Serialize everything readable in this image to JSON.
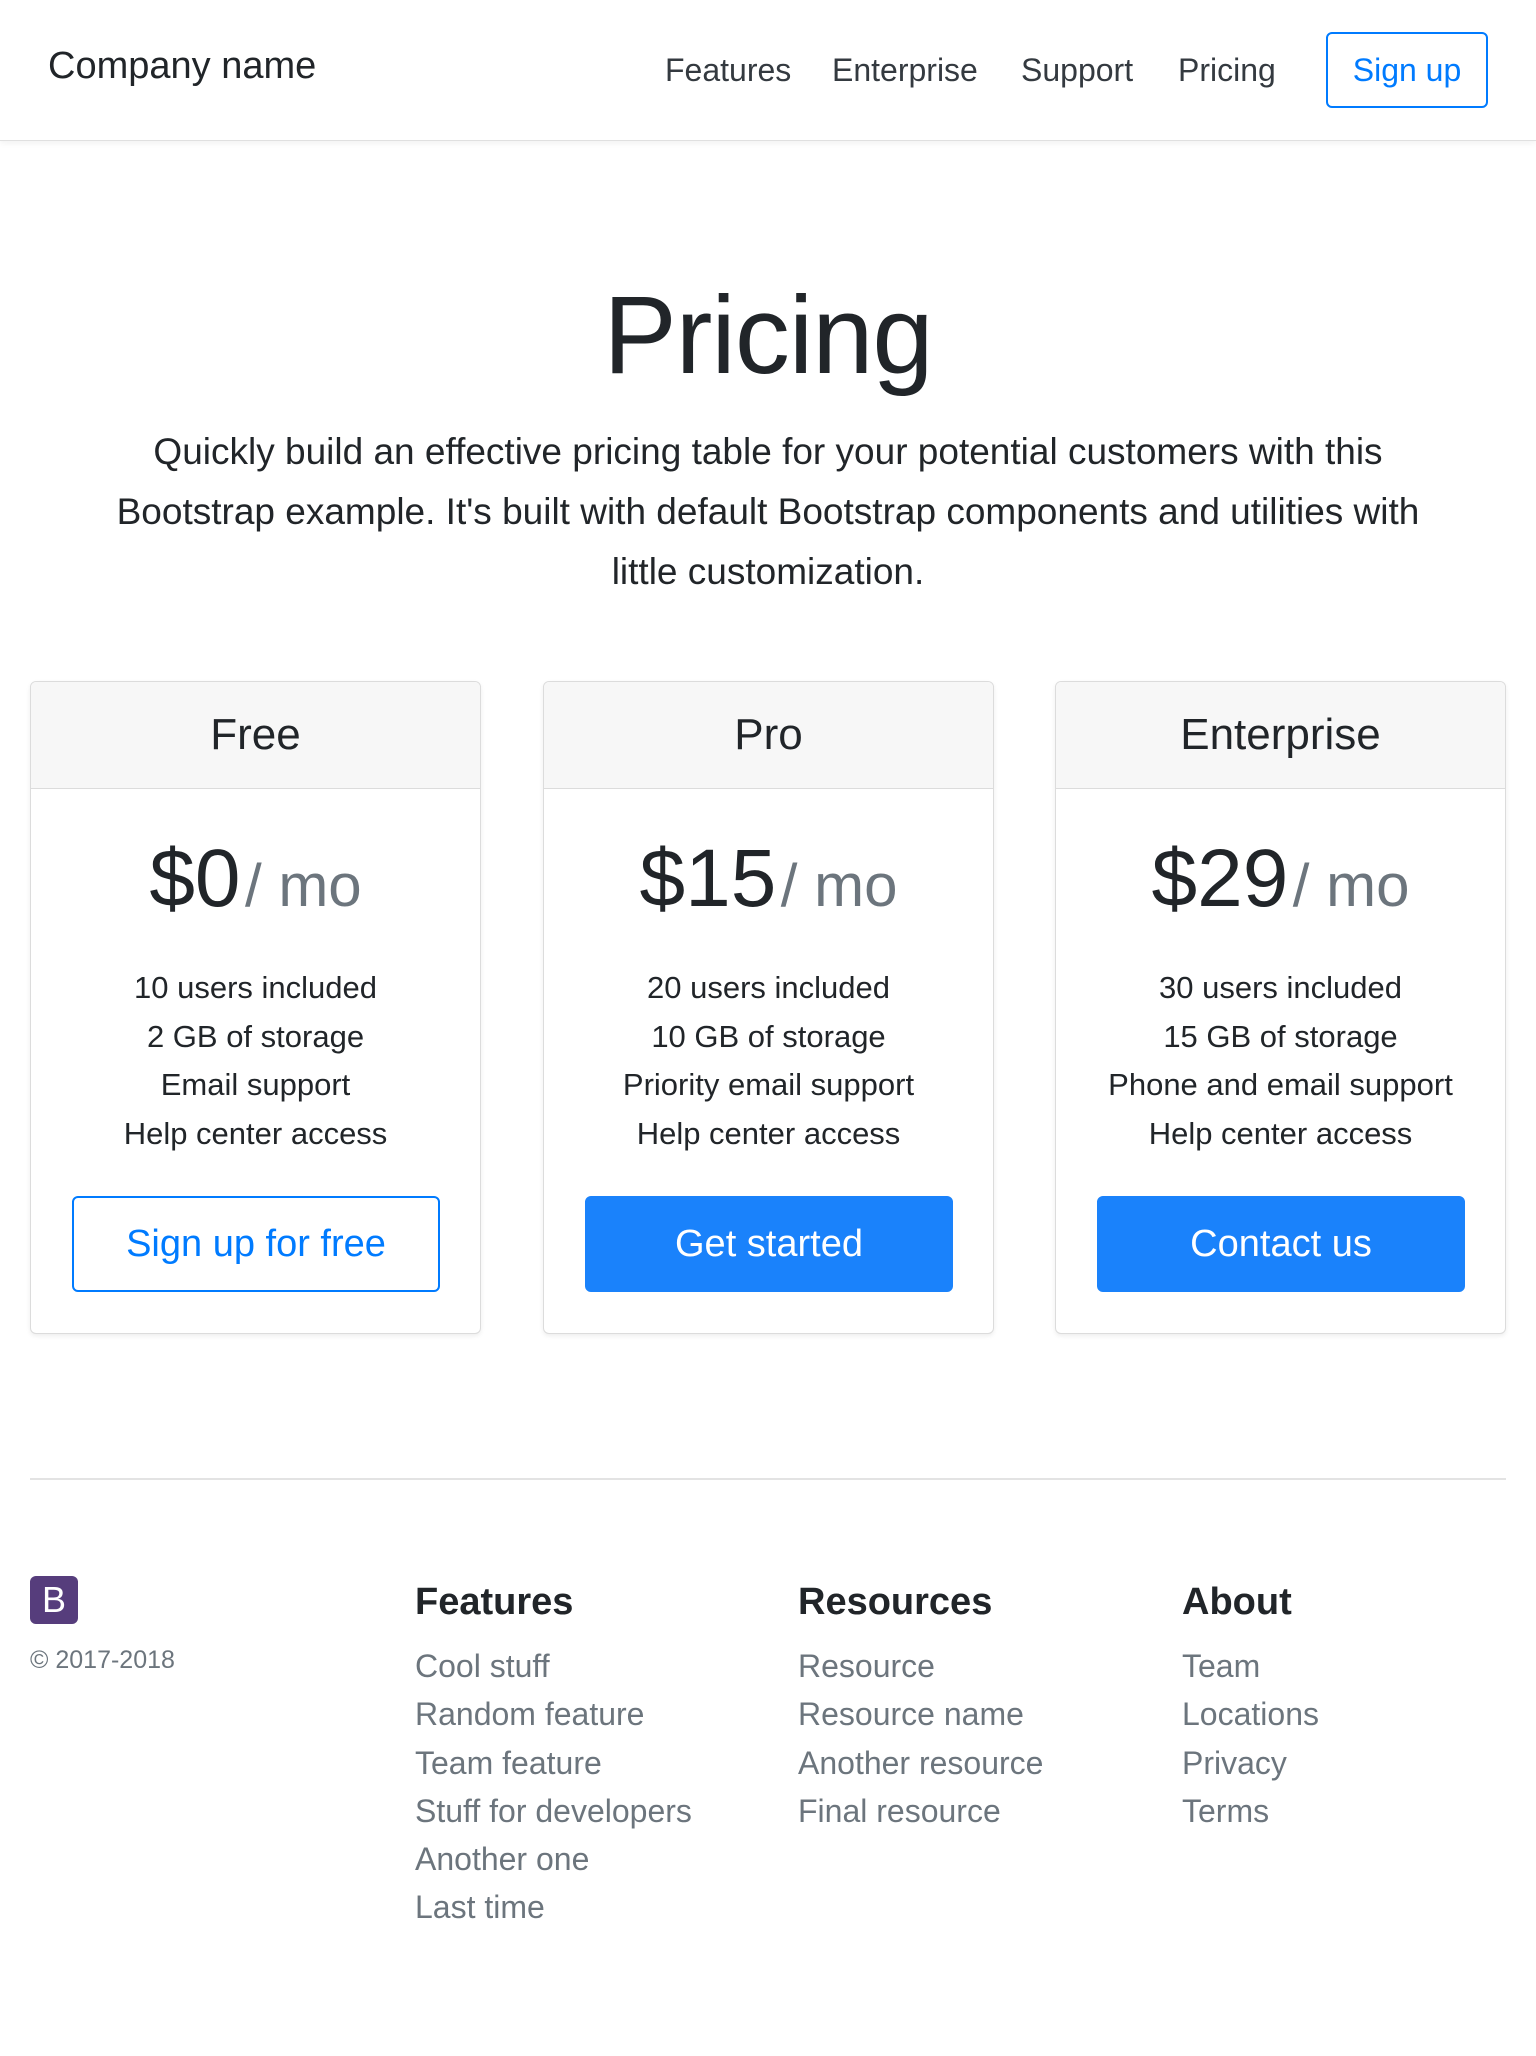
{
  "navbar": {
    "brand": "Company name",
    "links": [
      "Features",
      "Enterprise",
      "Support",
      "Pricing"
    ],
    "signup_label": "Sign up"
  },
  "hero": {
    "title": "Pricing",
    "lead": "Quickly build an effective pricing table for your potential customers with this Bootstrap example. It's built with default Bootstrap components and utilities with little customization."
  },
  "plans": [
    {
      "name": "Free",
      "price": "$0",
      "unit": "/ mo",
      "features": [
        "10 users included",
        "2 GB of storage",
        "Email support",
        "Help center access"
      ],
      "button": "Sign up for free"
    },
    {
      "name": "Pro",
      "price": "$15",
      "unit": "/ mo",
      "features": [
        "20 users included",
        "10 GB of storage",
        "Priority email support",
        "Help center access"
      ],
      "button": "Get started"
    },
    {
      "name": "Enterprise",
      "price": "$29",
      "unit": "/ mo",
      "features": [
        "30 users included",
        "15 GB of storage",
        "Phone and email support",
        "Help center access"
      ],
      "button": "Contact us"
    }
  ],
  "footer": {
    "logo_letter": "B",
    "copyright": "© 2017-2018",
    "columns": [
      {
        "heading": "Features",
        "links": [
          "Cool stuff",
          "Random feature",
          "Team feature",
          "Stuff for developers",
          "Another one",
          "Last time"
        ]
      },
      {
        "heading": "Resources",
        "links": [
          "Resource",
          "Resource name",
          "Another resource",
          "Final resource"
        ]
      },
      {
        "heading": "About",
        "links": [
          "Team",
          "Locations",
          "Privacy",
          "Terms"
        ]
      }
    ]
  },
  "colors": {
    "primary": "#007bff",
    "primary_button": "#1a82fb",
    "muted": "#6c757d",
    "logo": "#563d7c"
  }
}
